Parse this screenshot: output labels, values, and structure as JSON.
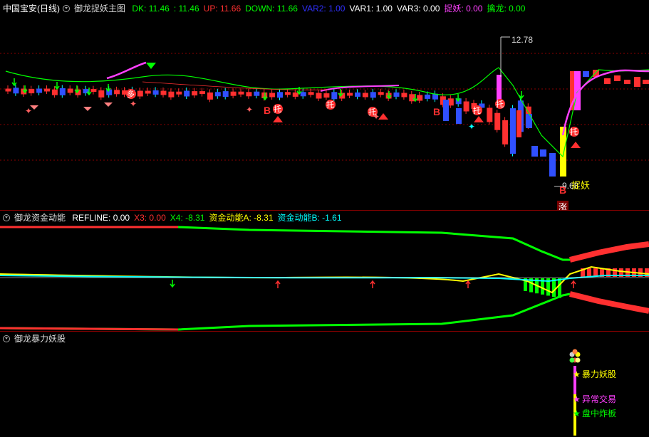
{
  "panel1": {
    "title": "中国宝安(日线)",
    "indicator": "御龙捉妖主图",
    "params": [
      {
        "label": "DK: 11.46",
        "color": "#00ff00"
      },
      {
        "label": ": 11.46",
        "color": "#00ff00"
      },
      {
        "label": "UP: 11.66",
        "color": "#ff3030"
      },
      {
        "label": "DOWN: 11.66",
        "color": "#00ff00"
      },
      {
        "label": "VAR2: 1.00",
        "color": "#3030ff"
      },
      {
        "label": "VAR1: 1.00",
        "color": "#ffffff"
      },
      {
        "label": "VAR3: 0.00",
        "color": "#ffffff"
      },
      {
        "label": "捉妖: 0.00",
        "color": "#ff40ff"
      },
      {
        "label": "擒龙: 0.00",
        "color": "#00ff00"
      }
    ],
    "price_high_label": "12.78",
    "price_low_label": "9.68",
    "zhuoyao_label": "捉妖",
    "b_label": "B",
    "zhang_label": "涨",
    "tuo_label": "托",
    "duo_label": "多"
  },
  "panel2": {
    "indicator": "御龙资金动能",
    "params": [
      {
        "label": "REFLINE: 0.00",
        "color": "#ffffff"
      },
      {
        "label": "X3: 0.00",
        "color": "#ff3030"
      },
      {
        "label": "X4: -8.31",
        "color": "#00ff00"
      },
      {
        "label": "资金动能A: -8.31",
        "color": "#ffff00"
      },
      {
        "label": "资金动能B: -1.61",
        "color": "#00ffff"
      }
    ]
  },
  "panel3": {
    "indicator": "御龙暴力妖股",
    "labels": [
      {
        "text": "暴力妖股",
        "color": "#ffff00"
      },
      {
        "text": "异常交易",
        "color": "#ff40ff"
      },
      {
        "text": "盘中炸板",
        "color": "#00ff00"
      }
    ]
  },
  "colors": {
    "up": "#ff3030",
    "down": "#00ffff",
    "grid": "#8a0000",
    "ma_green": "#00ff00",
    "ma_magenta": "#ff40ff"
  }
}
